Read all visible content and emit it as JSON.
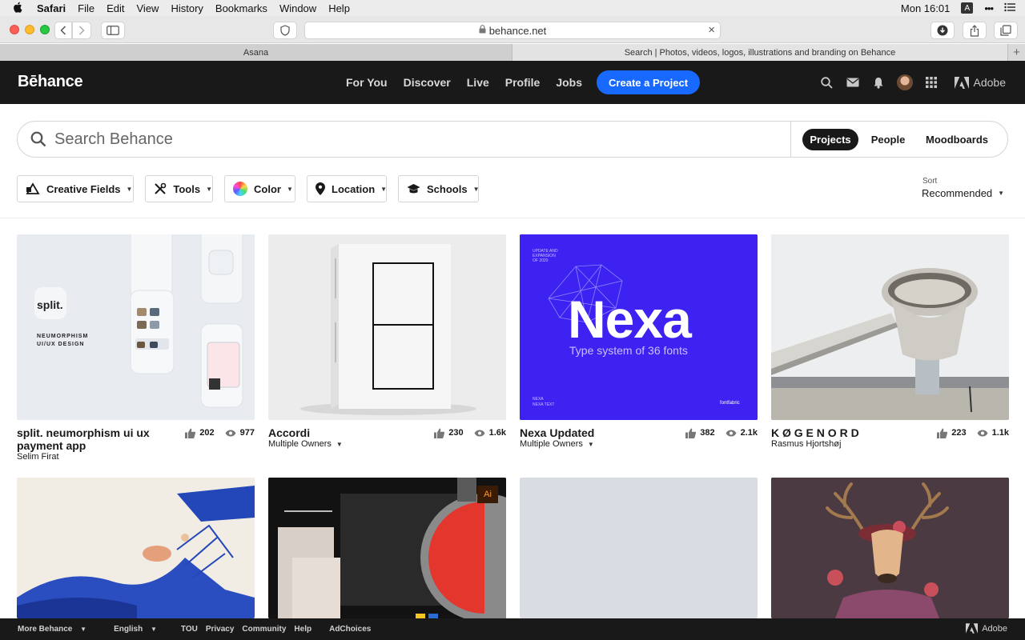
{
  "menubar": {
    "app": "Safari",
    "items": [
      "File",
      "Edit",
      "View",
      "History",
      "Bookmarks",
      "Window",
      "Help"
    ],
    "clock": "Mon 16:01",
    "input_badge": "A"
  },
  "browser": {
    "url": "behance.net",
    "tabs": [
      {
        "label": "Asana"
      },
      {
        "label": "Search | Photos, videos, logos, illustrations and branding on Behance"
      }
    ],
    "new_tab": "+"
  },
  "header": {
    "logo": "Bēhance",
    "nav": [
      "For You",
      "Discover",
      "Live",
      "Profile",
      "Jobs"
    ],
    "create_button": "Create a Project",
    "adobe": "Adobe"
  },
  "search": {
    "placeholder": "Search Behance",
    "tabs": [
      "Projects",
      "People",
      "Moodboards"
    ],
    "active_tab": "Projects"
  },
  "filters": {
    "items": [
      "Creative Fields",
      "Tools",
      "Color",
      "Location",
      "Schools"
    ],
    "sort_label": "Sort",
    "sort_value": "Recommended"
  },
  "projects": [
    {
      "title": "split. neumorphism ui ux payment app",
      "owner": "Selim Firat",
      "likes": "202",
      "views": "977"
    },
    {
      "title": "Accordi",
      "owner": "Multiple Owners",
      "likes": "230",
      "views": "1.6k"
    },
    {
      "title": "Nexa Updated",
      "owner": "Multiple Owners",
      "likes": "382",
      "views": "2.1k"
    },
    {
      "title": "K Ø G E N O R D",
      "owner": "Rasmus Hjortshøj",
      "likes": "223",
      "views": "1.1k"
    }
  ],
  "thumb_text": {
    "split_logo": "split.",
    "split_line1": "NEUMORPHISM",
    "split_line2": "UI/UX DESIGN",
    "nexa_title": "Nexa",
    "nexa_sub": "Type system of 36 fonts",
    "nexa_top1": "UPDATE AND",
    "nexa_top2": "EXPANSION",
    "nexa_top3": "OF 2020",
    "nexa_bl1": "NEXA",
    "nexa_bl2": "NEXA TEXT",
    "nexa_br": "fontfabric",
    "ai_badge": "Ai"
  },
  "colors": {
    "brand_blue": "#1769ff",
    "header_bg": "#191919",
    "nexa_bg": "#3d22f2"
  },
  "footer": {
    "more": "More Behance",
    "language": "English",
    "links": [
      "TOU",
      "Privacy",
      "Community",
      "Help"
    ],
    "adchoices": "AdChoices",
    "adobe": "Adobe"
  }
}
